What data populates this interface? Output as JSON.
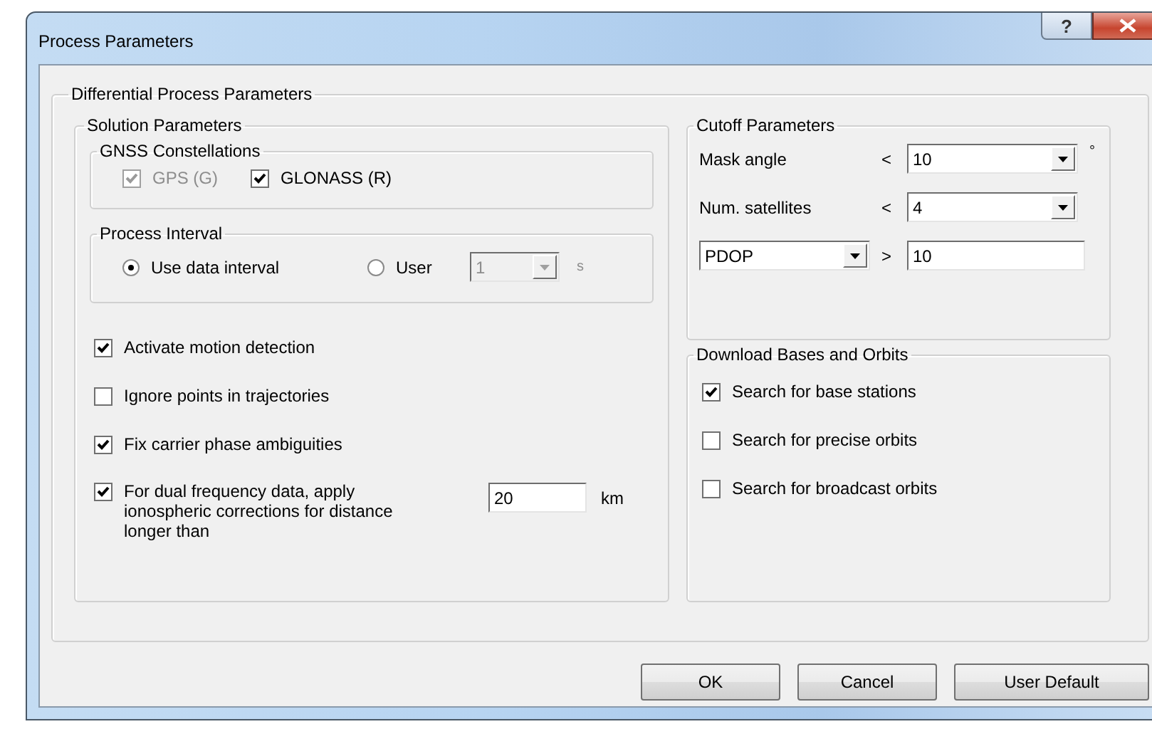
{
  "window": {
    "title": "Process Parameters",
    "help": "?"
  },
  "outer_group": {
    "title": "Differential Process Parameters"
  },
  "solution": {
    "title": "Solution Parameters",
    "gnss": {
      "title": "GNSS Constellations",
      "options": [
        {
          "label": "GPS (G)",
          "checked": true,
          "disabled": true
        },
        {
          "label": "GLONASS (R)",
          "checked": true,
          "disabled": false
        }
      ]
    },
    "interval": {
      "title": "Process Interval",
      "options": [
        {
          "label": "Use data interval",
          "selected": true
        },
        {
          "label": "User",
          "selected": false
        }
      ],
      "user_value": "1",
      "unit": "s",
      "disabled": true
    },
    "checks": [
      {
        "kind": "plain",
        "label": "Activate motion detection",
        "checked": true
      },
      {
        "kind": "plain",
        "label": "Ignore points in trajectories",
        "checked": false
      },
      {
        "kind": "plain",
        "label": "Fix carrier phase ambiguities",
        "checked": true
      },
      {
        "kind": "with_field",
        "label": "For dual frequency data, apply ionospheric corrections for distance longer than",
        "checked": true,
        "value": "20",
        "unit": "km"
      }
    ]
  },
  "cutoff": {
    "title": "Cutoff Parameters",
    "rows": [
      {
        "kind": "label",
        "label": "Mask angle",
        "operator": "<",
        "value": "10",
        "unit": "°"
      },
      {
        "kind": "label",
        "label": "Num. satellites",
        "operator": "<",
        "value": "4"
      },
      {
        "kind": "select",
        "label": "PDOP",
        "operator": ">",
        "value": "10"
      }
    ]
  },
  "download": {
    "title": "Download Bases and Orbits",
    "options": [
      {
        "label": "Search for base stations",
        "checked": true
      },
      {
        "label": "Search for precise orbits",
        "checked": false
      },
      {
        "label": "Search for broadcast orbits",
        "checked": false
      }
    ]
  },
  "buttons": [
    "OK",
    "Cancel",
    "User Default"
  ]
}
